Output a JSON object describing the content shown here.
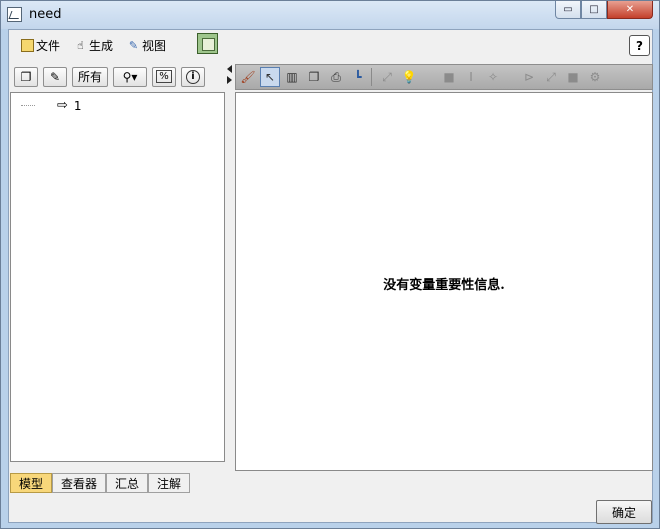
{
  "window": {
    "title": "need",
    "min_symbol": "▭",
    "max_symbol": "□",
    "close_symbol": "✕"
  },
  "menu": [
    {
      "id": "file",
      "label": "文件",
      "icon": "file-icon"
    },
    {
      "id": "generate",
      "label": "生成",
      "icon": "hand-icon"
    },
    {
      "id": "view",
      "label": "视图",
      "icon": "brush-icon"
    }
  ],
  "help_label": "?",
  "left_toolbar": {
    "all_label": "所有",
    "percent_label": "%",
    "info_label": "i",
    "pin_label": "⚲▾"
  },
  "tree": {
    "items": [
      {
        "label": "1"
      }
    ]
  },
  "message": "没有变量重要性信息.",
  "tabs": [
    {
      "label": "模型",
      "active": true
    },
    {
      "label": "查看器",
      "active": false
    },
    {
      "label": "汇总",
      "active": false
    },
    {
      "label": "注解",
      "active": false
    }
  ],
  "ok_label": "确定",
  "colors": {
    "active_tab": "#f8d77a",
    "toolbar": "#b8b8b8",
    "frame": "#b9d1ea"
  }
}
